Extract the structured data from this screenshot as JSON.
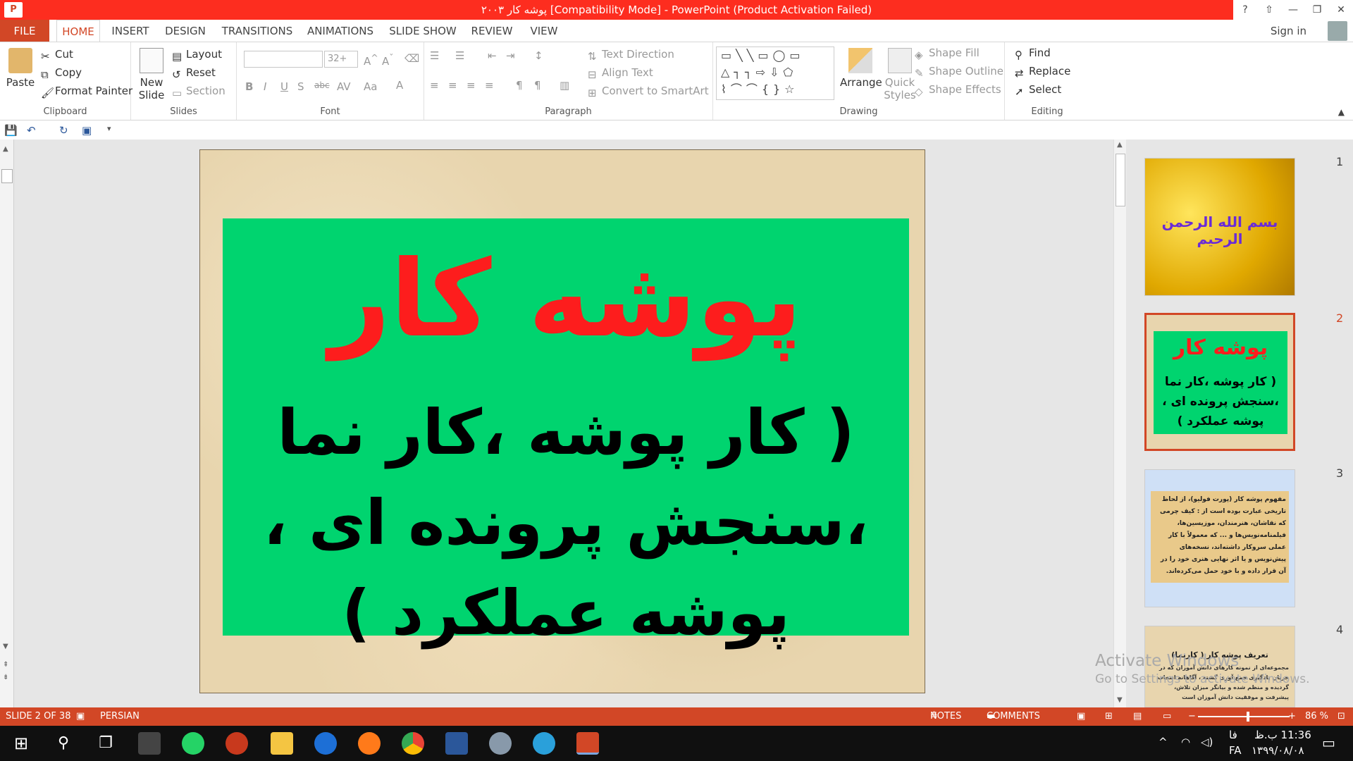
{
  "window": {
    "title": "پوشه کار ۲۰۰۳ [Compatibility Mode] -  PowerPoint (Product Activation Failed)",
    "app_icon": "P",
    "help": "?",
    "restore_ribbon": "⇧",
    "minimize": "—",
    "maximize": "❐",
    "close": "✕"
  },
  "tabs": [
    "FILE",
    "HOME",
    "INSERT",
    "DESIGN",
    "TRANSITIONS",
    "ANIMATIONS",
    "SLIDE SHOW",
    "REVIEW",
    "VIEW"
  ],
  "signin": "Sign in",
  "ribbon": {
    "clipboard": {
      "label": "Clipboard",
      "paste": "Paste",
      "cut": "Cut",
      "copy": "Copy",
      "format_painter": "Format Painter"
    },
    "slides": {
      "label": "Slides",
      "new_slide_1": "New",
      "new_slide_2": "Slide",
      "layout": "Layout",
      "reset": "Reset",
      "section": "Section"
    },
    "font": {
      "label": "Font",
      "size": "32+"
    },
    "paragraph": {
      "label": "Paragraph",
      "text_direction": "Text Direction",
      "align_text": "Align Text",
      "convert_smartart": "Convert to SmartArt"
    },
    "drawing": {
      "label": "Drawing",
      "arrange": "Arrange",
      "quick_styles_1": "Quick",
      "quick_styles_2": "Styles",
      "shape_fill": "Shape Fill",
      "shape_outline": "Shape Outline",
      "shape_effects": "Shape Effects"
    },
    "editing": {
      "label": "Editing",
      "find": "Find",
      "replace": "Replace",
      "select": "Select"
    }
  },
  "slide": {
    "title": "پوشه کار",
    "subtitle": "( کار پوشه ،کار نما ،سنجش پرونده ای ، پوشه عملکرد )"
  },
  "thumbnails": [
    {
      "num": "1",
      "text": "بسم الله الرحمن الرحیم"
    },
    {
      "num": "2",
      "title": "پوشه کار",
      "text": "( کار پوشه ،کار نما ،سنجش پرونده ای ، پوشه عملکرد )"
    },
    {
      "num": "3",
      "text": "مفهوم پوشه کار (پورت فولیو)، از لحاظ تاریخی عبارت بوده است از : کیف چرمی که نقاشان، هنرمندان، موزیسین‌ها، فیلمنامه‌نویس‌ها و ... که معمولاً با کار عملی سروکار داشته‌اند، نسخه‌های پیش‌نویس و یا اثر نهایی هنری خود را در آن قرار داده و با خود حمل می‌کرده‌اند."
    },
    {
      "num": "4",
      "title": "تعریف پوشه کار ( کارنما)",
      "text": "مجموعه‌ای از نمونه کارهای دانش آموزان که در جریان یادگیری جمع آوری گشته ، آگاهانه انتخاب گردیده و منظم شده و بیانگر میزان تلاش، پیشرفت و موفقیت دانش آموزان است"
    }
  ],
  "watermark": {
    "line1": "Activate Windows",
    "line2": "Go to Settings to activate Windows."
  },
  "status": {
    "slide": "SLIDE 2 OF 38",
    "language": "PERSIAN",
    "notes": "NOTES",
    "comments": "COMMENTS",
    "zoom": "86 %",
    "zoom_level": 0.55
  },
  "taskbar": {
    "time": "11:36 ب.ظ",
    "date": "۱۳۹۹/۰۸/۰۸",
    "lang": "FA",
    "lang2": "فا"
  }
}
